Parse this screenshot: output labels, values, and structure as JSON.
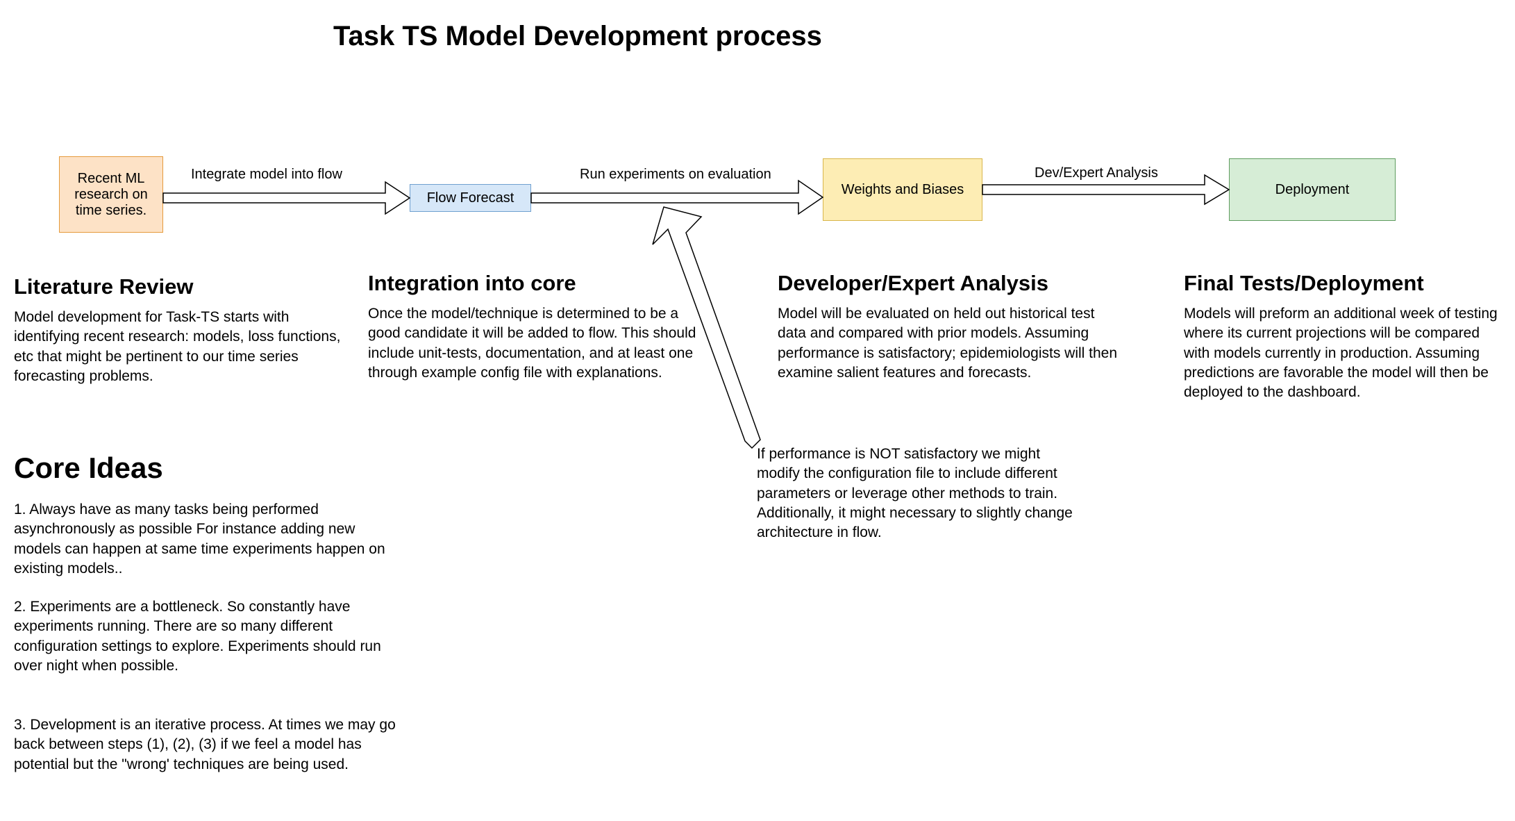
{
  "title": "Task TS Model Development process",
  "nodes": {
    "research": {
      "label": "Recent ML research on time series.",
      "fill": "#FDE2C6",
      "stroke": "#E59A3C"
    },
    "flow": {
      "label": "Flow Forecast",
      "fill": "#D6E7F8",
      "stroke": "#6FA0CF"
    },
    "wandb": {
      "label": "Weights and Biases",
      "fill": "#FDEDB4",
      "stroke": "#D9B64B"
    },
    "deploy": {
      "label": "Deployment",
      "fill": "#D6EDD6",
      "stroke": "#5F9C5F"
    }
  },
  "arrows": {
    "a1": "Integrate model into flow",
    "a2": "Run experiments on evaluation",
    "a3": "Dev/Expert Analysis"
  },
  "sections": {
    "lit": {
      "heading": "Literature Review",
      "body": "Model development for Task-TS starts with identifying recent research: models, loss functions, etc that might be pertinent to our time series forecasting problems."
    },
    "integ": {
      "heading": "Integration into core",
      "body": "Once the model/technique is determined to be a good candidate it will be added to flow. This should include unit-tests, documentation, and at least one through example config file with explanations."
    },
    "dev": {
      "heading": "Developer/Expert Analysis",
      "body": "Model will be evaluated on held out historical test data and compared with prior models. Assuming performance is satisfactory; epidemiologists will then examine salient features and forecasts."
    },
    "final": {
      "heading": "Final Tests/Deployment",
      "body": "Models will preform an additional week of testing where its current projections will be compared with models currently in production. Assuming predictions are favorable the model will then be deployed to the dashboard."
    }
  },
  "feedback_note": "If performance is NOT satisfactory we might modify the configuration file to include different parameters or leverage other methods to train. Additionally, it might necessary to slightly change architecture in flow.",
  "core_ideas": {
    "heading": "Core Ideas",
    "items": [
      "1. Always have as many tasks being performed asynchronously as possible For instance adding new models can happen at same time experiments happen on existing models..",
      "2. Experiments are a bottleneck. So constantly have experiments running. There are so many different configuration settings to explore. Experiments should run over night when possible.",
      "3. Development is an iterative process. At times we may go back between steps (1), (2), (3) if we feel a model has potential but the \"wrong' techniques are being used."
    ]
  }
}
